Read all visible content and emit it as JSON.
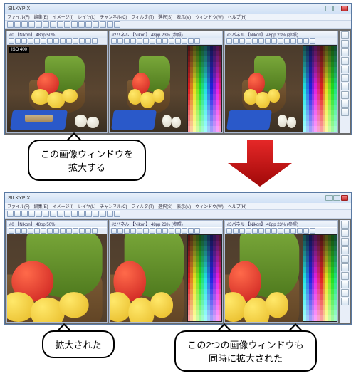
{
  "app": {
    "title": "SILKYPIX",
    "window_controls": [
      "minimize",
      "maximize",
      "close"
    ]
  },
  "menu": [
    "ファイル(F)",
    "編集(E)",
    "イメージ(I)",
    "レイヤ(L)",
    "チャンネル(C)",
    "フィルタ(T)",
    "選択(S)",
    "表示(V)",
    "ウィンドウ(W)",
    "ヘルプ(H)"
  ],
  "panels_before": [
    {
      "title": "#0 【Nikon】 48pp 50%",
      "badge": "ISO 400"
    },
    {
      "title": "#2パネル 【Nikon】 48pp 23% (参照)"
    },
    {
      "title": "#3パネル 【Nikon】 48pp 23% (参照)"
    }
  ],
  "panels_after": [
    {
      "title": "#0 【Nikon】 48pp 50%"
    },
    {
      "title": "#2パネル 【Nikon】 48pp 23% (参照)"
    },
    {
      "title": "#3パネル 【Nikon】 48pp 23% (参照)"
    }
  ],
  "captions": {
    "top": "この画像ウィンドウを\n拡大する",
    "bottom_left": "拡大された",
    "bottom_right": "この2つの画像ウィンドウも\n同時に拡大された"
  },
  "icons": {
    "toolbar_count": 16,
    "panel_tool_count": 14,
    "toolbox_count": 10
  }
}
